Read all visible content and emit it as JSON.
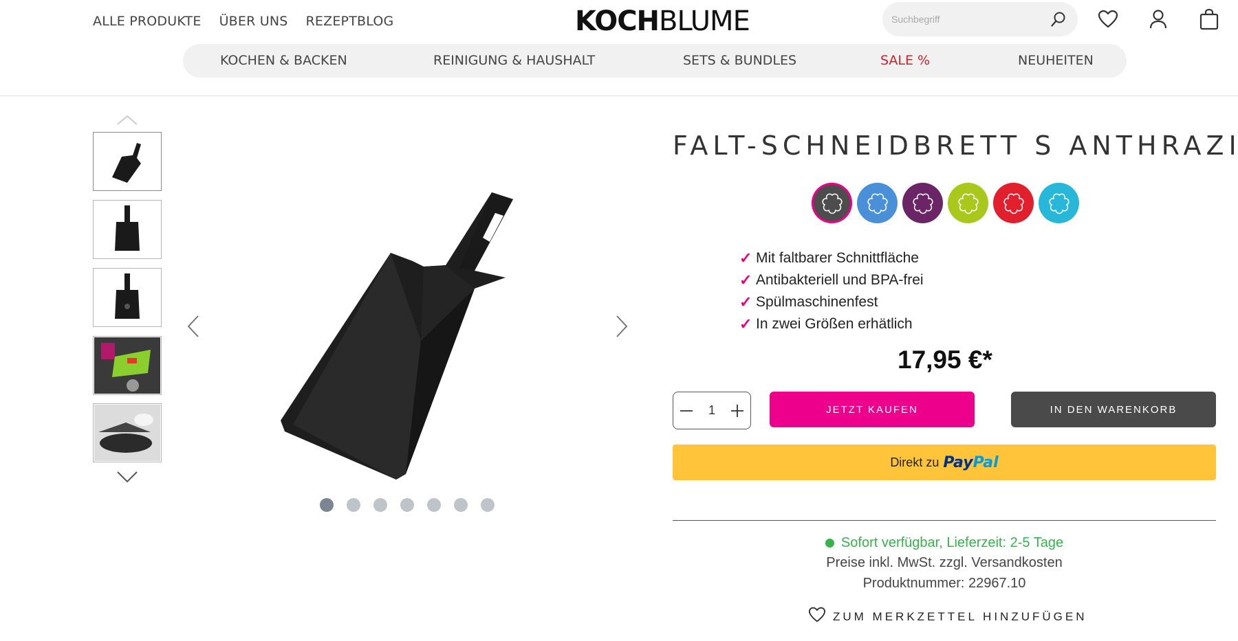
{
  "header": {
    "nav_left": [
      "ALLE PRODUKTE",
      "ÜBER UNS",
      "REZEPTBLOG"
    ],
    "logo_bold": "KOCH",
    "logo_light": "BLUME",
    "search_placeholder": "Suchbegriff",
    "icons": [
      "search-icon",
      "heart-icon",
      "user-icon",
      "bag-icon"
    ]
  },
  "categories": {
    "items": [
      {
        "label": "KOCHEN & BACKEN"
      },
      {
        "label": "REINIGUNG & HAUSHALT"
      },
      {
        "label": "SETS & BUNDLES"
      },
      {
        "label": "SALE %",
        "color": "#d11f2b"
      },
      {
        "label": "NEUHEITEN"
      }
    ]
  },
  "gallery": {
    "thumbnail_count": 5,
    "dot_count": 7,
    "active_dot": 1
  },
  "product": {
    "title": "FALT-SCHNEIDBRETT S ANTHRAZIT",
    "swatch_colors": [
      "#4d4d4d",
      "#4a90d9",
      "#6b2566",
      "#a8c81c",
      "#e21f2d",
      "#27b7d9"
    ],
    "selected_swatch": 1,
    "features": [
      "Mit faltbarer Schnittfläche",
      "Antibakteriell und BPA-frei",
      "Spülmaschinenfest",
      "In zwei Größen erhätlich"
    ],
    "price": "17,95 €*",
    "quantity": "1",
    "buy_now_label": "JETZT KAUFEN",
    "add_to_cart_label": "IN DEN WARENKORB",
    "paypal_prefix": "Direkt zu",
    "paypal_brand_1": "Pay",
    "paypal_brand_2": "Pal",
    "availability": "Sofort verfügbar, Lieferzeit: 2-5 Tage",
    "price_note": "Preise inkl. MwSt. zzgl. Versandkosten",
    "product_number": "Produktnummer: 22967.10",
    "wishlist_label": "ZUM MERKZETTEL HINZUFÜGEN"
  },
  "colors": {
    "accent_pink": "#ec008c",
    "cart_dark": "#4a4a4a",
    "paypal_yellow": "#ffc439",
    "available_green": "#37b24d"
  }
}
